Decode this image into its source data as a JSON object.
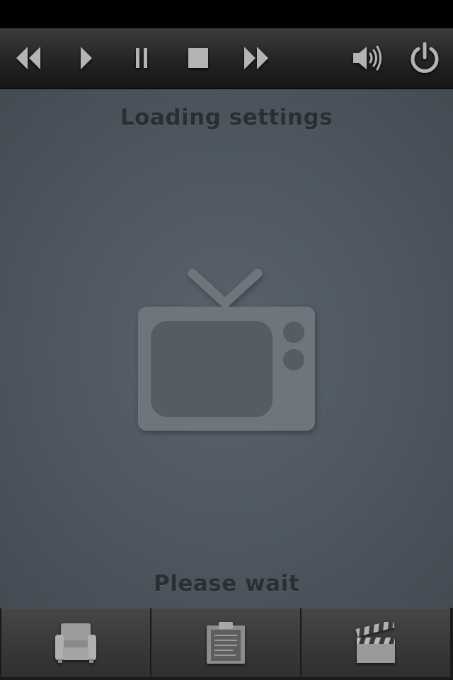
{
  "toolbar": {
    "buttons": [
      {
        "name": "rewind",
        "icon": "rewind-icon"
      },
      {
        "name": "play",
        "icon": "play-icon"
      },
      {
        "name": "pause",
        "icon": "pause-icon"
      },
      {
        "name": "stop",
        "icon": "stop-icon"
      },
      {
        "name": "fast-forward",
        "icon": "fast-forward-icon"
      },
      {
        "name": "volume",
        "icon": "volume-icon"
      },
      {
        "name": "power",
        "icon": "power-icon"
      }
    ]
  },
  "main": {
    "title": "Loading settings",
    "wait_text": "Please wait",
    "illustration_icon": "tv-icon"
  },
  "bottom_nav": {
    "tabs": [
      {
        "name": "tv-shows",
        "icon": "armchair-icon"
      },
      {
        "name": "files",
        "icon": "clipboard-icon"
      },
      {
        "name": "movies",
        "icon": "clapperboard-icon"
      }
    ]
  },
  "colors": {
    "icon": "#b4b4b4",
    "background": "#4f5861",
    "text": "#2b2f33",
    "tv": "#6e757d"
  }
}
